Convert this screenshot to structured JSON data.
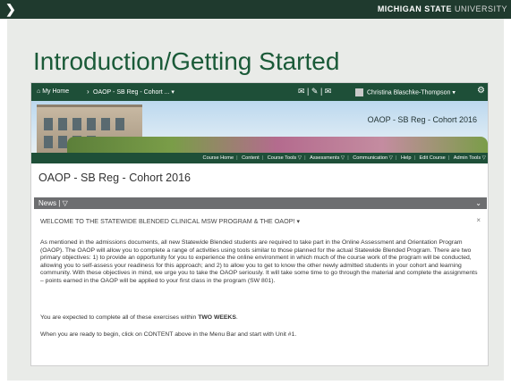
{
  "slide": {
    "header_right_bold": "MICHIGAN STATE",
    "header_right_light": " UNIVERSITY",
    "title": "Introduction/Getting Started"
  },
  "d2l_nav": {
    "home": "My Home",
    "course_select": "OAOP - SB Reg - Cohort ... ▾",
    "user_name": "Christina Blaschke-Thompson ▾"
  },
  "banner": {
    "title": "OAOP - SB Reg - Cohort 2016"
  },
  "course_nav": {
    "items": [
      "Course Home",
      "Content",
      "Course Tools ▽",
      "Assessments ▽",
      "Communication ▽",
      "Help",
      "Edit Course",
      "Admin Tools ▽"
    ]
  },
  "course_title": "OAOP - SB Reg - Cohort 2016",
  "news": {
    "header": "News",
    "header_caret": "▽",
    "headline": "WELCOME TO THE STATEWIDE BLENDED CLINICAL MSW PROGRAM & THE OAOP!",
    "headline_caret": "▾",
    "paragraph1": "As mentioned in the admissions documents, all new Statewide Blended students are required to take part in the Online Assessment and Orientation Program (OAOP).  The OAOP will allow you to complete a range of activities using tools similar to those planned for the actual Statewide Blended Program. There are two primary objectives: 1) to provide an opportunity for you to experience the online environment in which much of the course work of the program will be conducted, allowing you to self-assess your readiness for this approach; and 2) to allow you to get to know the other newly admitted students in your cohort and learning community.  With these objectives in mind, we urge you to take the OAOP seriously.  It will take some time to go through the material and complete the assignments – points earned in the OAOP will be applied to your first class in the program (SW 801).",
    "paragraph2_prefix": "You are expected to complete all of these exercises within ",
    "paragraph2_bold": "TWO WEEKS",
    "paragraph2_suffix": ".",
    "paragraph3": "When you are ready to begin, click on CONTENT above in the Menu Bar and start with Unit #1."
  },
  "colors": {
    "slide_bar": "#1f3a2e",
    "title_green": "#1a5a38",
    "d2l_green": "#1e4f38",
    "news_header": "#6d6e70",
    "slide_background": "#e9ebe8"
  }
}
